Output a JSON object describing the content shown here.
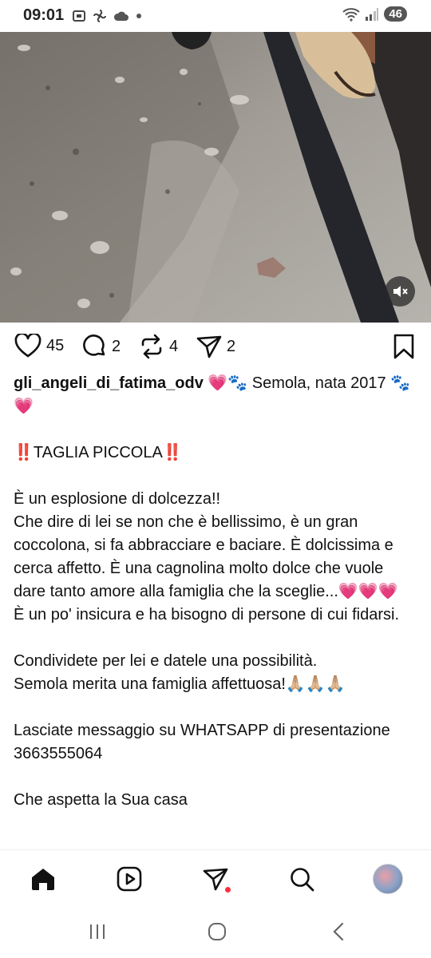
{
  "status_bar": {
    "time": "09:01",
    "battery": "46"
  },
  "post": {
    "likes": "45",
    "comments": "2",
    "reposts": "4",
    "shares": "2",
    "username": "gli_angeli_di_fatima_odv",
    "caption_lead": " 💗🐾 Semola, nata 2017 🐾💗",
    "caption_body": "\n\n‼️TAGLIA PICCOLA‼️\n\nÈ un esplosione di dolcezza!!\nChe dire di lei se non che è bellissimo, è un gran coccolona, si fa abbracciare e baciare. È dolcissima e cerca affetto. È una cagnolina molto dolce che vuole dare tanto amore alla famiglia che la sceglie...💗💗💗\nÈ un po' insicura e ha bisogno di persone di cui fidarsi.\n\nCondividete per lei e datele una possibilità.\nSemola merita una famiglia affettuosa!🙏🏼🙏🏼🙏🏼\n\nLasciate messaggio su WHATSAPP di presentazione 3663555064\n\nChe aspetta la Sua casa"
  },
  "icons": {
    "like": "heart-icon",
    "comment": "comment-icon",
    "repost": "repost-icon",
    "share": "send-icon",
    "save": "bookmark-icon",
    "mute": "speaker-muted-icon",
    "home": "home-icon",
    "reels": "reels-icon",
    "direct": "direct-icon",
    "search": "search-icon",
    "profile": "avatar"
  },
  "colors": {
    "notification_dot": "#ff3040",
    "text": "#111111"
  }
}
